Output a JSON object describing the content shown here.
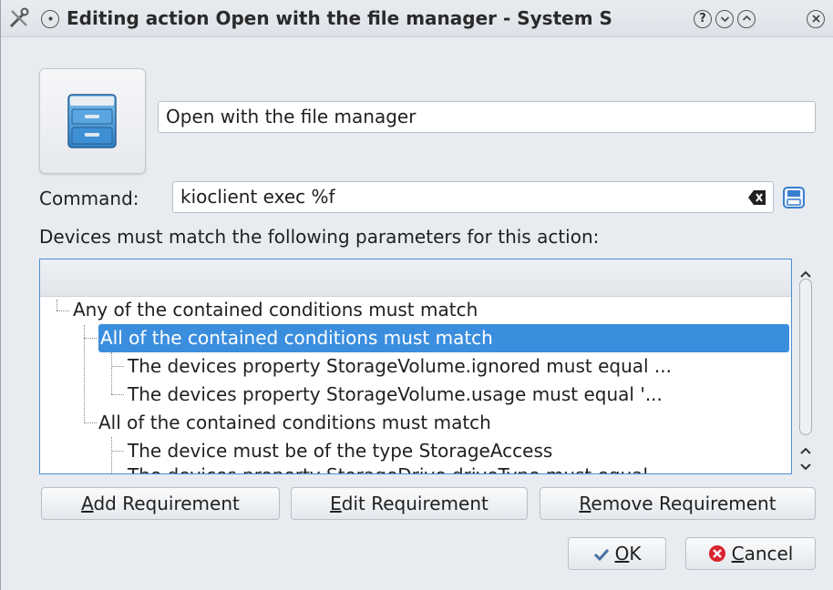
{
  "titlebar": {
    "title": "Editing action Open with the file manager - System S",
    "help_glyph": "?",
    "icons": [
      "tools-icon",
      "pin-icon",
      "help-icon",
      "minimize-icon",
      "maximize-icon",
      "close-icon"
    ]
  },
  "action": {
    "name": "Open with the file manager",
    "icon": "file-cabinet-icon"
  },
  "command": {
    "label": "Command:",
    "value": "kioclient exec %f"
  },
  "requirements": {
    "description": "Devices must match the following parameters for this action:",
    "tree": [
      {
        "label": "Any of the contained conditions must match"
      },
      {
        "label": "All of the contained conditions must match",
        "selected": true
      },
      {
        "label": "The devices property StorageVolume.ignored must equal ..."
      },
      {
        "label": "The devices property StorageVolume.usage must equal '..."
      },
      {
        "label": "All of the contained conditions must match"
      },
      {
        "label": "The device must be of the type StorageAccess"
      },
      {
        "label": "The devices property StorageDrive.driveType must equal"
      }
    ]
  },
  "buttons": {
    "add_pre": "",
    "add_ul": "A",
    "add_post": "dd Requirement",
    "edit_pre": "",
    "edit_ul": "E",
    "edit_post": "dit Requirement",
    "remove_pre": "",
    "remove_ul": "R",
    "remove_post": "emove Requirement",
    "ok_ul": "O",
    "ok_post": "K",
    "cancel_ul": "C",
    "cancel_post": "ancel"
  },
  "colors": {
    "selection": "#3b8ede",
    "focus_border": "#4b8fd6",
    "cancel_icon": "#d9232f",
    "ok_icon": "#4a6fa5"
  }
}
